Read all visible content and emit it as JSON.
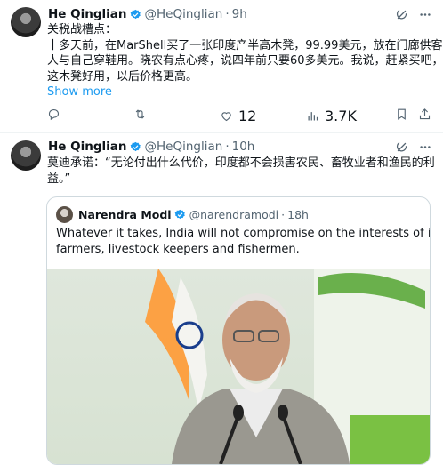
{
  "tweets": [
    {
      "display_name": "He Qinglian",
      "handle": "@HeQinglian",
      "sep": "·",
      "time": "9h",
      "lines": [
        "关税战槽点：",
        "十多天前，在MarShell买了一张印度产半高木凳，99.99美元，放在门廊供客",
        "人与自己穿鞋用。晓农有点心疼，说四年前只要60多美元。我说，赶紧买吧，",
        "这木凳好用，以后价格更高。"
      ],
      "show_more": "Show more",
      "likes": "12",
      "views": "3.7K"
    },
    {
      "display_name": "He Qinglian",
      "handle": "@HeQinglian",
      "sep": "·",
      "time": "10h",
      "lines": [
        "莫迪承诺：“无论付出什么代价，印度都不会损害农民、畜牧业者和渔民的利",
        "益。”"
      ],
      "quote": {
        "display_name": "Narendra Modi",
        "handle": "@narendramodi",
        "sep": "·",
        "time": "18h",
        "lines": [
          "Whatever it takes, India will not compromise on the interests of its",
          "farmers, livestock keepers and fishermen."
        ]
      }
    }
  ],
  "colors": {
    "accent": "#1d9bf0",
    "muted": "#536471",
    "border": "#cfd9de"
  },
  "icons": [
    "grok-icon",
    "more-icon",
    "reply-icon",
    "retweet-icon",
    "like-icon",
    "views-icon",
    "bookmark-icon",
    "share-icon",
    "verified-icon"
  ]
}
